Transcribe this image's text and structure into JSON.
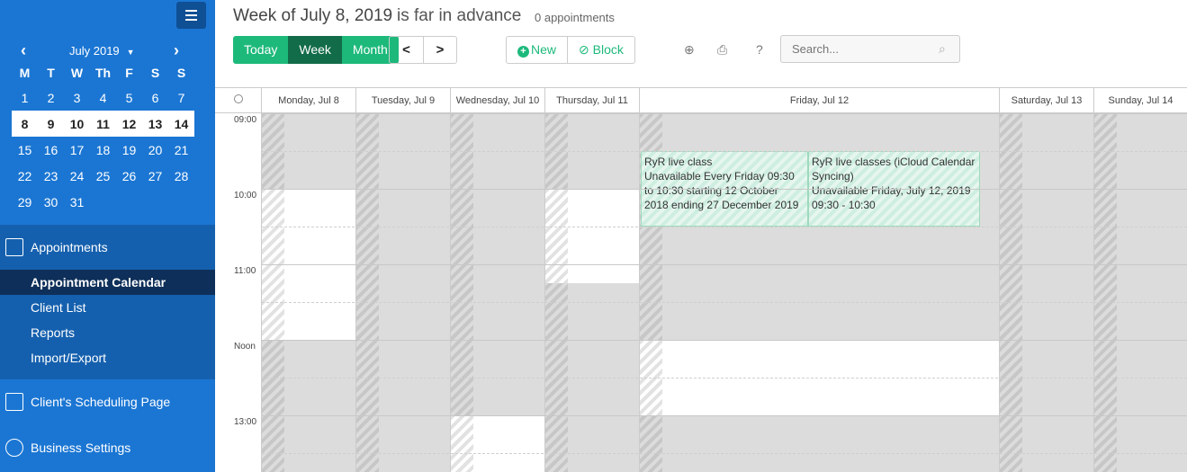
{
  "sidebar": {
    "month_label": "July 2019",
    "weekdays": [
      "M",
      "T",
      "W",
      "Th",
      "F",
      "S",
      "S"
    ],
    "days": [
      "1",
      "2",
      "3",
      "4",
      "5",
      "6",
      "7",
      "8",
      "9",
      "10",
      "11",
      "12",
      "13",
      "14",
      "15",
      "16",
      "17",
      "18",
      "19",
      "20",
      "21",
      "22",
      "23",
      "24",
      "25",
      "26",
      "27",
      "28",
      "29",
      "30",
      "31"
    ],
    "appointments_label": "Appointments",
    "sub_items": [
      "Appointment Calendar",
      "Client List",
      "Reports",
      "Import/Export"
    ],
    "scheduling_label": "Client's Scheduling Page",
    "settings_label": "Business Settings"
  },
  "header": {
    "title": "Week of July 8, 2019",
    "subtitle": "is far in advance",
    "count": "0 appointments",
    "view_buttons": [
      "Today",
      "Week",
      "Month"
    ],
    "active_view": "Week",
    "new_label": "New",
    "block_label": "Block",
    "search_placeholder": "Search..."
  },
  "calendar": {
    "day_headers": [
      "Monday, Jul 8",
      "Tuesday, Jul 9",
      "Wednesday, Jul 10",
      "Thursday, Jul 11",
      "Friday, Jul 12",
      "Saturday, Jul 13",
      "Sunday, Jul 14"
    ],
    "time_labels": [
      "09:00",
      "10:00",
      "11:00",
      "Noon",
      "13:00"
    ],
    "events": [
      {
        "line1": "RyR live class",
        "line2": "Unavailable Every Friday 09:30 to 10:30 starting 12 October 2018 ending 27 December 2019"
      },
      {
        "line1": "RyR live classes (iCloud Calendar Syncing)",
        "line2": "Unavailable Friday, July 12, 2019 09:30 - 10:30"
      }
    ]
  },
  "colors": {
    "sidebar_bg": "#1b76d3",
    "accent": "#1db97b",
    "active_view": "#126c49"
  }
}
